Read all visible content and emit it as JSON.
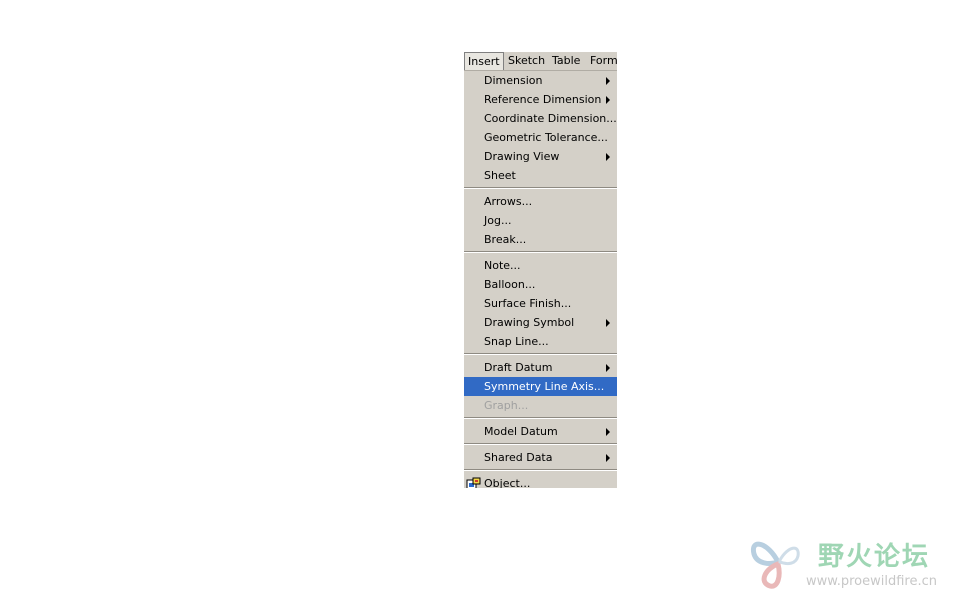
{
  "menubar": {
    "items": [
      {
        "label": "Insert",
        "active": true
      },
      {
        "label": "Sketch"
      },
      {
        "label": "Table"
      },
      {
        "label": "Forma"
      }
    ]
  },
  "insert_menu": {
    "items": [
      {
        "label": "Dimension"
      },
      {
        "label": "Reference Dimension"
      },
      {
        "label": "Coordinate Dimension..."
      },
      {
        "label": "Geometric Tolerance..."
      },
      {
        "label": "Drawing View"
      },
      {
        "label": "Sheet"
      },
      {
        "label": "Arrows..."
      },
      {
        "label": "Jog..."
      },
      {
        "label": "Break..."
      },
      {
        "label": "Note..."
      },
      {
        "label": "Balloon..."
      },
      {
        "label": "Surface Finish..."
      },
      {
        "label": "Drawing Symbol"
      },
      {
        "label": "Snap Line..."
      },
      {
        "label": "Draft Datum"
      },
      {
        "label": "Symmetry Line Axis..."
      },
      {
        "label": "Graph..."
      },
      {
        "label": "Model Datum"
      },
      {
        "label": "Shared Data"
      },
      {
        "label": "Object..."
      }
    ]
  },
  "watermark": {
    "title": "野火论坛",
    "url": "www.proewildfire.cn"
  },
  "colors": {
    "menu_background": "#d4d0c8",
    "highlight": "#316ac5",
    "disabled_text": "#a0a0a0"
  }
}
